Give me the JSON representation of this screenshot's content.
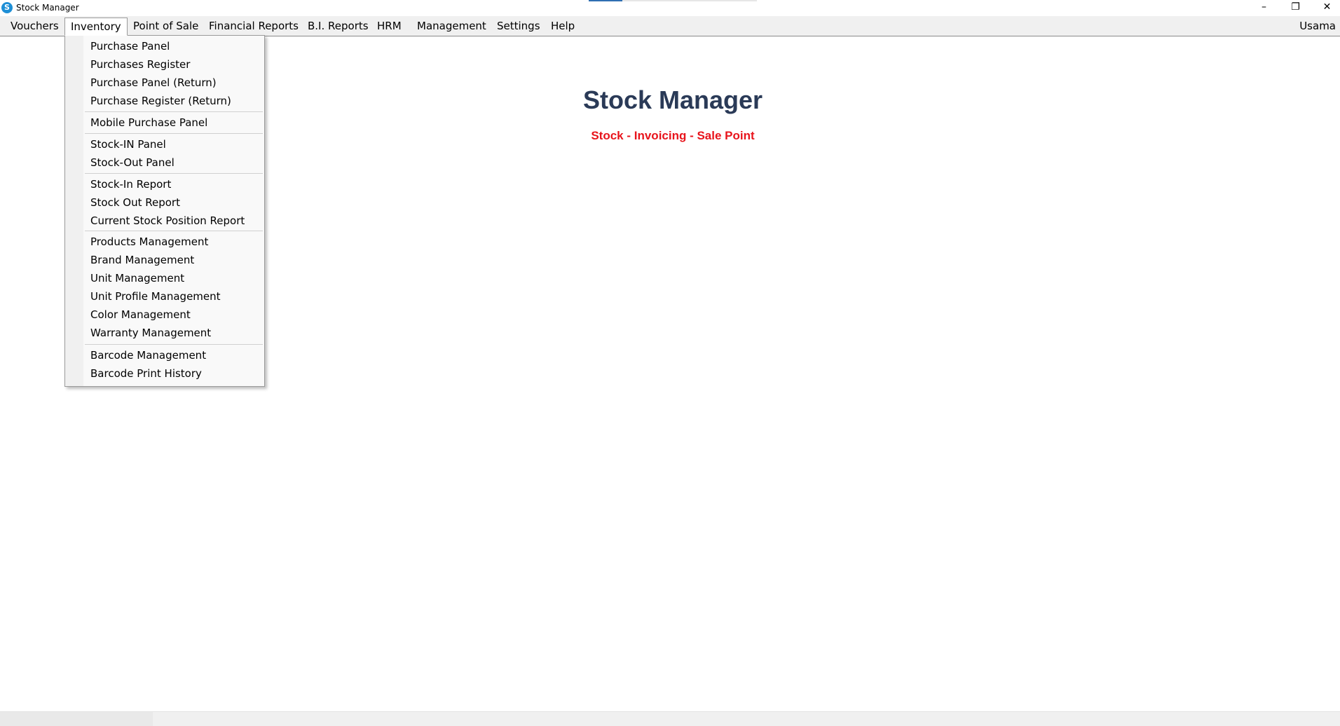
{
  "window": {
    "title": "Stock Manager",
    "icon_letter": "S",
    "progress_fraction": 0.2,
    "minimize_glyph": "–",
    "maximize_glyph": "❐",
    "close_glyph": "✕"
  },
  "menubar": {
    "items": [
      {
        "label": "Vouchers"
      },
      {
        "label": "Inventory",
        "open": true
      },
      {
        "label": "Point of Sale"
      },
      {
        "label": "Financial Reports"
      },
      {
        "label": "B.I. Reports"
      },
      {
        "label": "HRM"
      },
      {
        "label": "Management"
      },
      {
        "label": "Settings"
      },
      {
        "label": "Help"
      }
    ],
    "user": "Usama"
  },
  "inventory_menu": {
    "groups": [
      [
        "Purchase Panel",
        "Purchases Register",
        "Purchase Panel (Return)",
        "Purchase Register (Return)"
      ],
      [
        "Mobile Purchase Panel"
      ],
      [
        "Stock-IN Panel",
        "Stock-Out Panel"
      ],
      [
        "Stock-In Report",
        "Stock Out Report",
        "Current Stock Position Report"
      ],
      [
        "Products Management",
        "Brand Management",
        "Unit Management",
        "Unit Profile Management",
        "Color Management",
        "Warranty Management"
      ],
      [
        "Barcode Management",
        "Barcode Print History"
      ]
    ]
  },
  "main": {
    "title": "Stock Manager",
    "subtitle": "Stock - Invoicing - Sale Point"
  },
  "colors": {
    "title": "#2a3a57",
    "subtitle": "#e8141c",
    "menubar_bg": "#f0f0f0",
    "progress_fill": "#2f6fb2"
  }
}
